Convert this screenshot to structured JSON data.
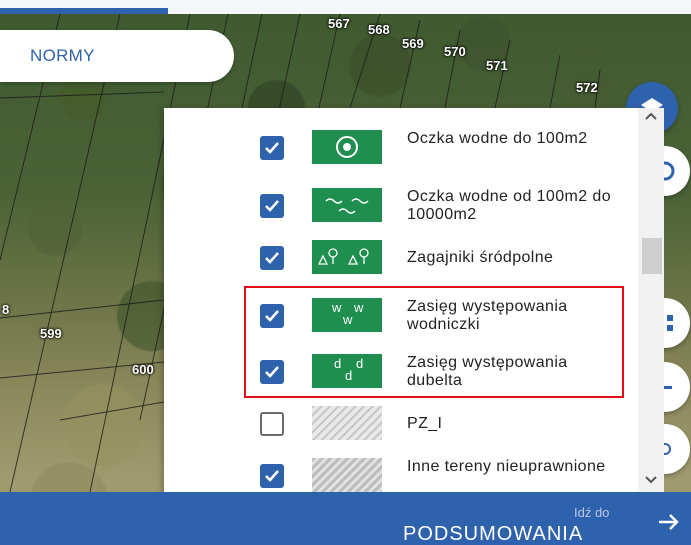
{
  "map": {
    "parcel_numbers": [
      "567",
      "568",
      "569",
      "570",
      "571",
      "572",
      "599",
      "600",
      "8"
    ]
  },
  "normy_tab": {
    "label": "NORMY"
  },
  "legend": {
    "items": [
      {
        "label": "Oczka wodne do 100m2",
        "checked": true,
        "icon": "pond-small-icon",
        "symbol_text": ""
      },
      {
        "label": "Oczka wodne od 100m2 do 10000m2",
        "checked": true,
        "icon": "pond-large-icon",
        "symbol_text": ""
      },
      {
        "label": "Zagajniki śródpolne",
        "checked": true,
        "icon": "tree-clusters-icon",
        "symbol_text": ""
      },
      {
        "label": "Zasięg występowania wodniczki",
        "checked": true,
        "icon": "wodniczka-icon",
        "symbol_text": "w w w"
      },
      {
        "label": "Zasięg występowania dubelta",
        "checked": true,
        "icon": "dubelt-icon",
        "symbol_text": "d d d"
      },
      {
        "label": "PZ_I",
        "checked": false,
        "icon": "hatch-icon",
        "symbol_text": ""
      },
      {
        "label": "Inne tereny nieuprawnione",
        "checked": true,
        "icon": "hatch-gray-icon",
        "symbol_text": ""
      }
    ]
  },
  "bottom_bar": {
    "small_label": "Idź do",
    "main_label": "PODSUMOWANIA"
  },
  "colors": {
    "accent": "#2f62ad",
    "legend_green": "#1e8f4e",
    "highlight": "#e0101a"
  }
}
